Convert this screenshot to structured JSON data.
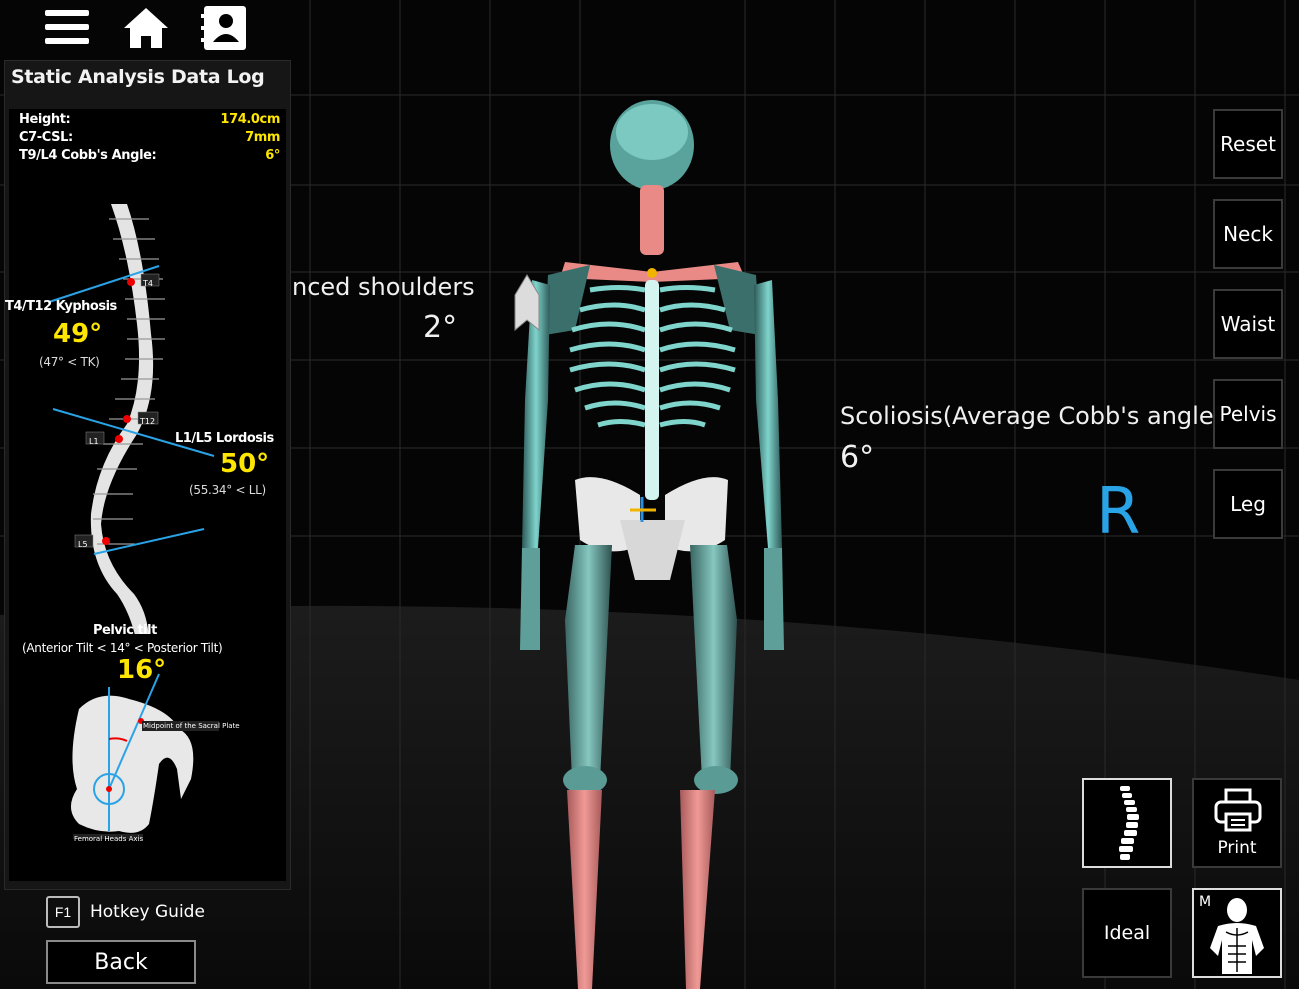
{
  "toolbar": {
    "menu_icon": "hamburger-menu-icon",
    "home_icon": "home-icon",
    "contact_icon": "contact-book-icon"
  },
  "data_log": {
    "title": "Static Analysis Data Log",
    "measurements": [
      {
        "label": "Height:",
        "value": "174.0cm"
      },
      {
        "label": "C7-CSL:",
        "value": "7mm"
      },
      {
        "label": "T9/L4 Cobb's Angle:",
        "value": "6°"
      }
    ],
    "spine": {
      "vertebra_tags": [
        "T4",
        "T12",
        "L1",
        "L5"
      ],
      "kyphosis_title": "T4/T12 Kyphosis",
      "kyphosis_value": "49°",
      "kyphosis_ref": "(47° < TK)",
      "lordosis_title": "L1/L5 Lordosis",
      "lordosis_value": "50°",
      "lordosis_ref": "(55.34° < LL)"
    },
    "pelvis": {
      "title": "Pelvic tilt",
      "ref": "(Anterior Tilt < 14° < Posterior Tilt)",
      "value": "16°",
      "sacral_label": "Midpoint of the Sacral Plate",
      "femoral_label": "Femoral Heads Axis"
    }
  },
  "view": {
    "shoulder_label": "nced shoulders",
    "shoulder_value": "2°",
    "scoliosis_label": "Scoliosis(Average Cobb's angle)",
    "scoliosis_value": "6°",
    "side_letter": "R"
  },
  "side_buttons": [
    "Reset",
    "Neck",
    "Waist",
    "Pelvis",
    "Leg"
  ],
  "bottom_buttons": {
    "spine_icon": "spine-icon",
    "print_label": "Print",
    "ideal_label": "Ideal",
    "muscle_tag": "M",
    "muscle_icon": "muscle-body-icon"
  },
  "footer": {
    "hotkey_key": "F1",
    "hotkey_label": "Hotkey Guide",
    "back_label": "Back"
  },
  "colors": {
    "value_yellow": "#ffe600",
    "accent_blue": "#2aa3e6",
    "bone_teal": "#6fd0c8",
    "highlight_red": "#e27a7a"
  }
}
